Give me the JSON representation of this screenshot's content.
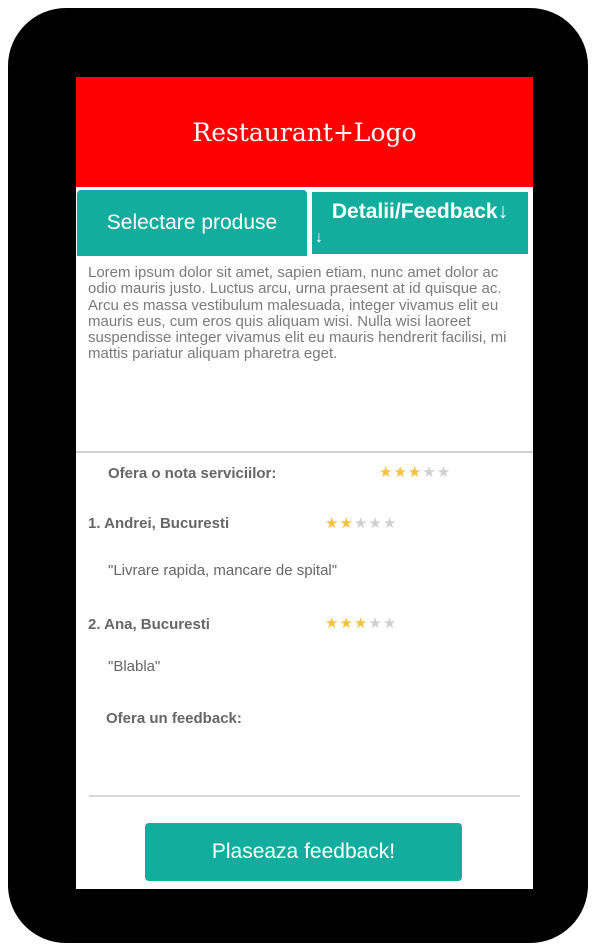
{
  "header": {
    "title": "Restaurant+Logo"
  },
  "tabs": {
    "produse": "Selectare produse",
    "detalii": "Detalii/Feedback↓",
    "detalii_extra": "↓"
  },
  "description": "Lorem ipsum dolor sit amet, sapien etiam, nunc amet dolor ac odio mauris justo. Luctus arcu, urna praesent at id quisque ac. Arcu es massa vestibulum malesuada, integer vivamus elit eu mauris eus, cum eros quis aliquam wisi. Nulla wisi laoreet suspendisse integer vivamus elit eu mauris hendrerit facilisi, mi mattis pariatur aliquam pharetra eget.",
  "rating_prompt": {
    "label": "Ofera o nota serviciilor:",
    "stars": 3,
    "max": 5
  },
  "reviews": [
    {
      "author": "1. Andrei, Bucuresti",
      "stars": 2,
      "max": 5,
      "quote": "\"Livrare rapida, mancare de spital\""
    },
    {
      "author": "2. Ana, Bucuresti",
      "stars": 3,
      "max": 5,
      "quote": "\"Blabla\""
    }
  ],
  "feedback": {
    "label": "Ofera un feedback:",
    "input_value": ""
  },
  "submit_button": "Plaseaza feedback!",
  "colors": {
    "header": "#ff0000",
    "accent": "#12ad9c",
    "star_on": "#f5c143",
    "star_off": "#cfcfcf"
  }
}
